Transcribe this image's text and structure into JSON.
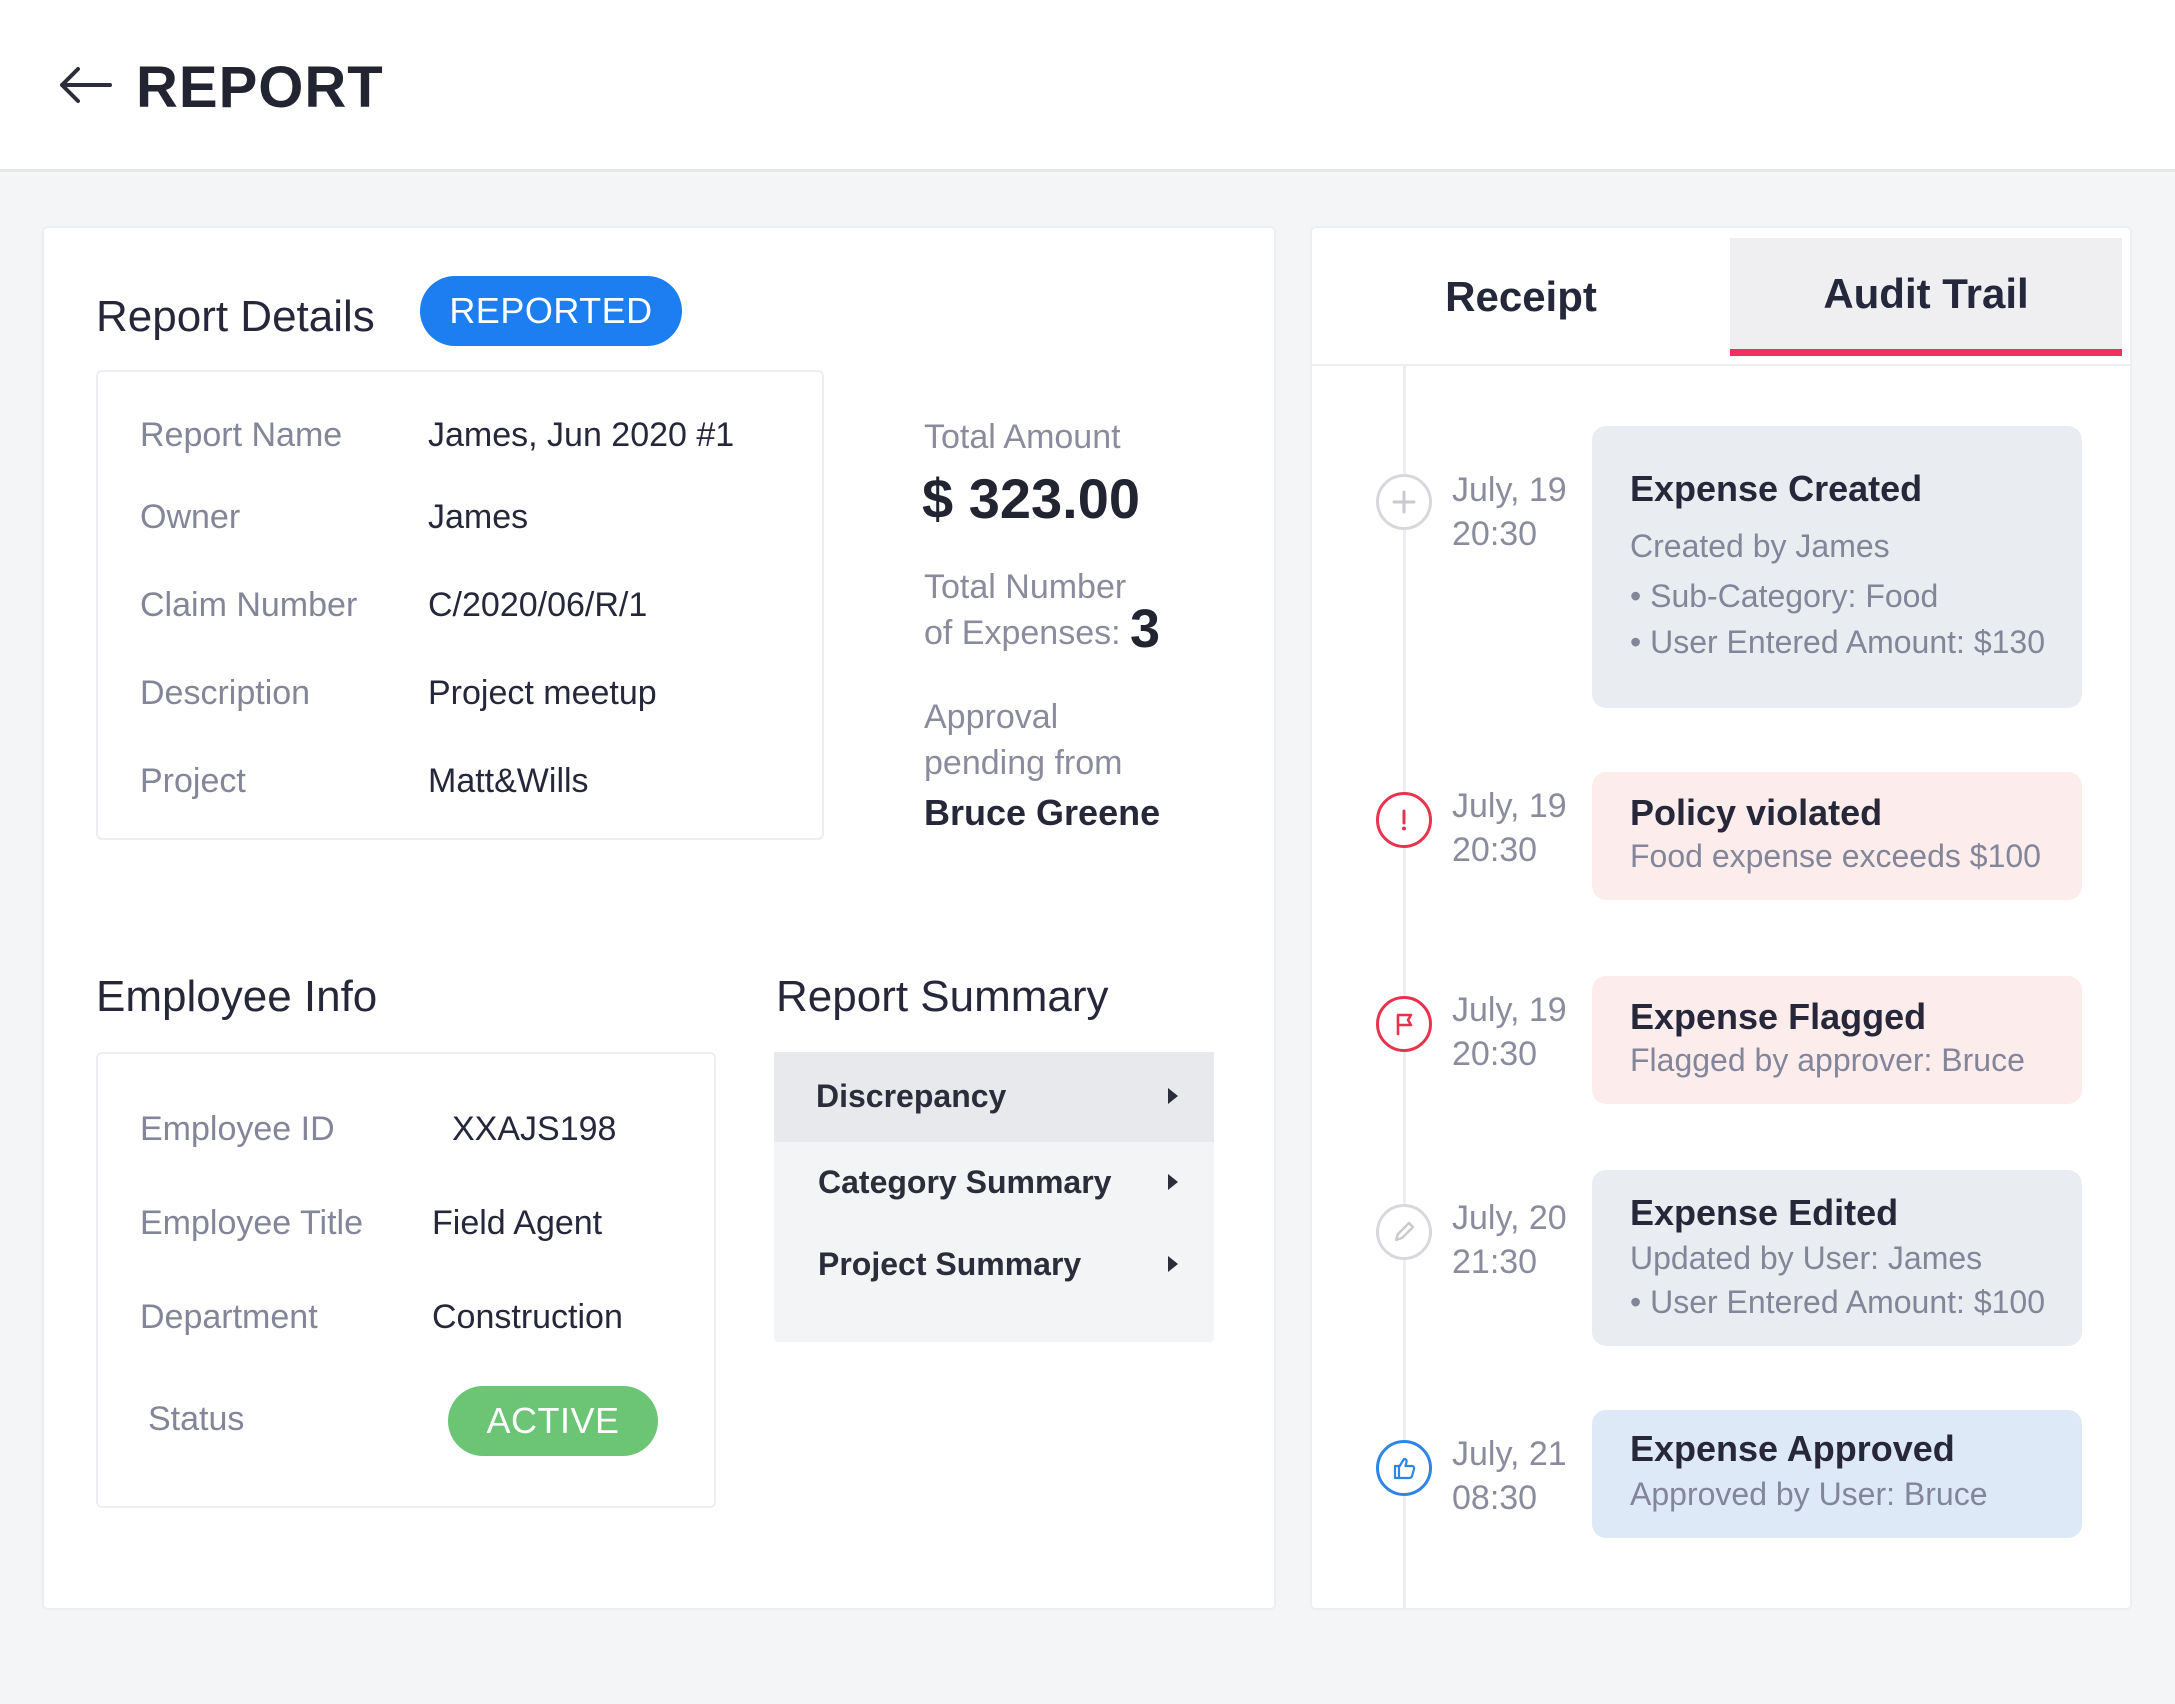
{
  "header": {
    "title": "REPORT"
  },
  "report_details": {
    "title": "Report Details",
    "status_badge": "REPORTED",
    "status_color": "#1c7ef0",
    "rows": [
      {
        "label": "Report Name",
        "value": "James, Jun 2020 #1"
      },
      {
        "label": "Owner",
        "value": "James"
      },
      {
        "label": "Claim Number",
        "value": "C/2020/06/R/1"
      },
      {
        "label": "Description",
        "value": "Project meetup"
      },
      {
        "label": "Project",
        "value": "Matt&Wills"
      }
    ]
  },
  "stats": {
    "total_amount_label": "Total Amount",
    "total_amount": "$ 323.00",
    "total_expenses_label_1": "Total Number",
    "total_expenses_label_2": "of Expenses:",
    "total_expenses": "3",
    "approval_label_1": "Approval",
    "approval_label_2": "pending from",
    "approver": "Bruce Greene"
  },
  "employee_info": {
    "title": "Employee Info",
    "rows": [
      {
        "label": "Employee ID",
        "value": "XXAJS198"
      },
      {
        "label": "Employee Title",
        "value": "Field Agent"
      },
      {
        "label": "Department",
        "value": "Construction"
      }
    ],
    "status_label": "Status",
    "status_badge": "ACTIVE",
    "status_color": "#6cc475"
  },
  "report_summary": {
    "title": "Report Summary",
    "items": [
      {
        "label": "Discrepancy"
      },
      {
        "label": "Category Summary"
      },
      {
        "label": "Project Summary"
      }
    ]
  },
  "tabs": [
    {
      "label": "Receipt"
    },
    {
      "label": "Audit Trail"
    }
  ],
  "audit_trail": [
    {
      "icon": "plus-icon",
      "date": "July, 19",
      "time": "20:30",
      "title": "Expense Created",
      "subtitle": "Created by James",
      "bullets": [
        "• Sub-Category: Food",
        "• User Entered Amount: $130"
      ]
    },
    {
      "icon": "alert-icon",
      "date": "July, 19",
      "time": "20:30",
      "title": "Policy violated",
      "subtitle": "Food expense exceeds $100",
      "bullets": []
    },
    {
      "icon": "flag-icon",
      "date": "July, 19",
      "time": "20:30",
      "title": "Expense Flagged",
      "subtitle": "Flagged by approver: Bruce",
      "bullets": []
    },
    {
      "icon": "pencil-icon",
      "date": "July, 20",
      "time": "21:30",
      "title": "Expense Edited",
      "subtitle": "Updated by User: James",
      "bullets": [
        "• User Entered Amount: $100"
      ]
    },
    {
      "icon": "thumbs-up-icon",
      "date": "July, 21",
      "time": "08:30",
      "title": "Expense Approved",
      "subtitle": "Approved by User: Bruce",
      "bullets": []
    }
  ]
}
